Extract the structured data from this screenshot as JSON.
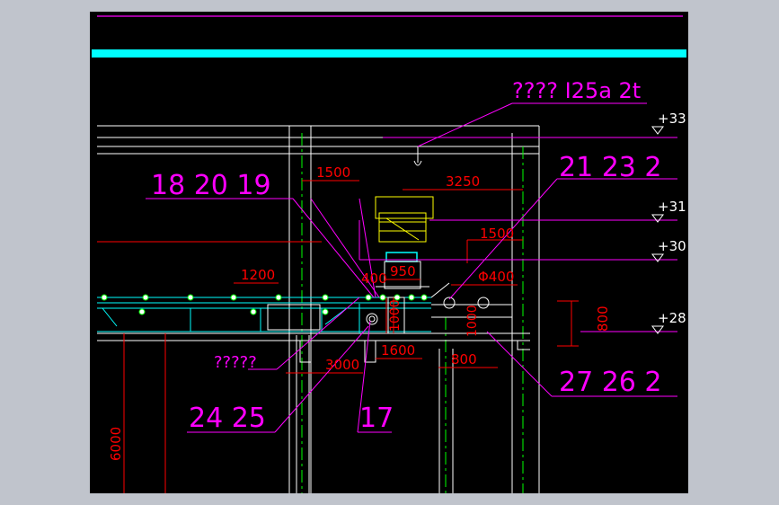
{
  "colors": {
    "background": "#c0c4cc",
    "canvas": "#000000",
    "structure": "#ffffff",
    "dimension": "#ff0000",
    "leader": "#ff00ff",
    "centerline": "#00ff00",
    "highlight": "#00ffff",
    "equipment": "#ffff00",
    "conveyor": "#00ffff"
  },
  "annotations": {
    "crane": "???? I25a 2t",
    "callout_a": "18  20  19",
    "callout_b": "21  23  2",
    "callout_c": "24  25",
    "callout_d": "17",
    "callout_e": "27  26  2",
    "unknown_label": "?????"
  },
  "elevations": [
    "+33",
    "+31",
    "+30",
    "+28"
  ],
  "dimensions": {
    "d1500_left": "1500",
    "d3250": "3250",
    "d1500_right": "1500",
    "d1200": "1200",
    "d400": "400",
    "d950": "950",
    "d_phi400": "Φ400",
    "d1000": "1000",
    "d1000_b": "1000",
    "d800_vert": "800",
    "d3000": "3000",
    "d1600": "1600",
    "d800": "800",
    "d6000": "6000"
  }
}
